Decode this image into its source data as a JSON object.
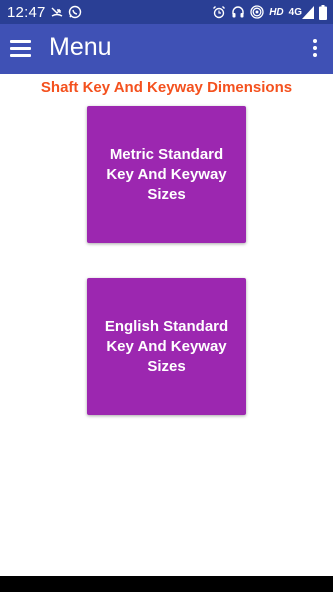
{
  "status_bar": {
    "time": "12:47",
    "hd_label": "HD",
    "network_label": "4G",
    "icons": [
      "missed-call-icon",
      "whatsapp-icon",
      "alarm-icon",
      "headset-icon",
      "hotspot-icon",
      "signal-icon",
      "battery-icon"
    ]
  },
  "app_bar": {
    "title": "Menu"
  },
  "content": {
    "heading": "Shaft Key And Keyway Dimensions",
    "buttons": [
      {
        "label": "Metric Standard Key And Keyway Sizes"
      },
      {
        "label": "English Standard Key And Keyway Sizes"
      }
    ]
  },
  "colors": {
    "status_bar": "#2a3f95",
    "app_bar": "#3f51b5",
    "heading": "#f4511e",
    "button": "#9c27b0"
  }
}
